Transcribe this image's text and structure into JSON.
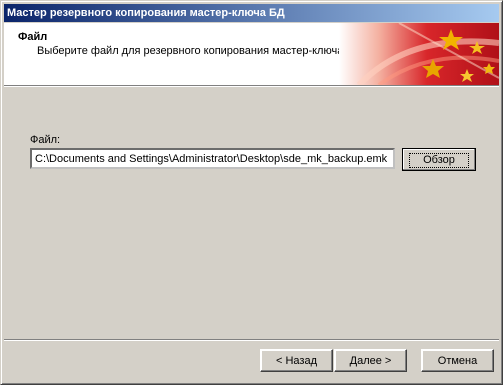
{
  "window": {
    "title": "Мастер резервного копирования мастер-ключа БД"
  },
  "header": {
    "title": "Файл",
    "subtitle": "Выберите файл для резервного копирования мастер-ключа БД",
    "banner_icon": "stars-banner"
  },
  "form": {
    "file_label": "Файл:",
    "file_path": "C:\\Documents and Settings\\Administrator\\Desktop\\sde_mk_backup.emk",
    "browse_label": "Обзор"
  },
  "footer": {
    "back_label": "< Назад",
    "next_label": "Далее >",
    "cancel_label": "Отмена"
  },
  "colors": {
    "titlebar_start": "#0a246a",
    "titlebar_end": "#a6caf0",
    "face": "#d4d0c8",
    "banner_red": "#cc1a1a"
  }
}
